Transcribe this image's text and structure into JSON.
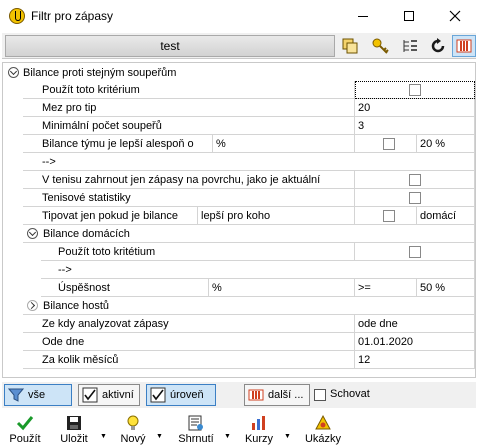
{
  "window": {
    "title": "Filtr pro zápasy"
  },
  "toolbar": {
    "preset": "test"
  },
  "tree": {
    "section1": {
      "label": "Bilance proti stejným soupeřům"
    },
    "r_pouzit": {
      "label": "Použít toto kritérium"
    },
    "r_mez": {
      "label": "Mez pro tip",
      "value": "20"
    },
    "r_min": {
      "label": "Minimální počet soupeřů",
      "value": "3"
    },
    "r_bil": {
      "label": "Bilance týmu je lepší alespoň o",
      "unit": "%",
      "value": "20 %"
    },
    "r_arrow": {
      "label": "-->"
    },
    "r_tenis": {
      "label": "V tenisu zahrnout jen zápasy na povrchu, jako je aktuální"
    },
    "r_stat": {
      "label": "Tenisové statistiky"
    },
    "r_tip": {
      "label": "Tipovat jen pokud je bilance",
      "mid": "lepší pro koho",
      "value": "domácí"
    },
    "section2": {
      "label": "Bilance domácích"
    },
    "r2_pouzit": {
      "label": "Použít toto kritétium"
    },
    "r2_arrow": {
      "label": "-->"
    },
    "r2_usp": {
      "label": "Úspěšnost",
      "unit": "%",
      "op": ">=",
      "value": "50 %"
    },
    "section3": {
      "label": "Bilance hostů"
    },
    "r3_kdy": {
      "label": "Ze kdy analyzovat zápasy",
      "value": "ode dne"
    },
    "r3_od": {
      "label": "Ode dne",
      "value": "01.01.2020"
    },
    "r3_kolik": {
      "label": "Za kolik měsíců",
      "value": "12"
    }
  },
  "filterbar": {
    "vse": "vše",
    "aktivni": "aktivní",
    "uroven": "úroveň",
    "dalsi": "další ...",
    "schovat": "Schovat"
  },
  "bottombar": {
    "pouzit": "Použít",
    "ulozit": "Uložit",
    "novy": "Nový",
    "shrnuti": "Shrnutí",
    "kurzy": "Kurzy",
    "ukazky": "Ukázky"
  },
  "colors": {
    "accent": "#cde4f7",
    "accent_border": "#3b7fc4",
    "grid": "#d4d4d4"
  }
}
